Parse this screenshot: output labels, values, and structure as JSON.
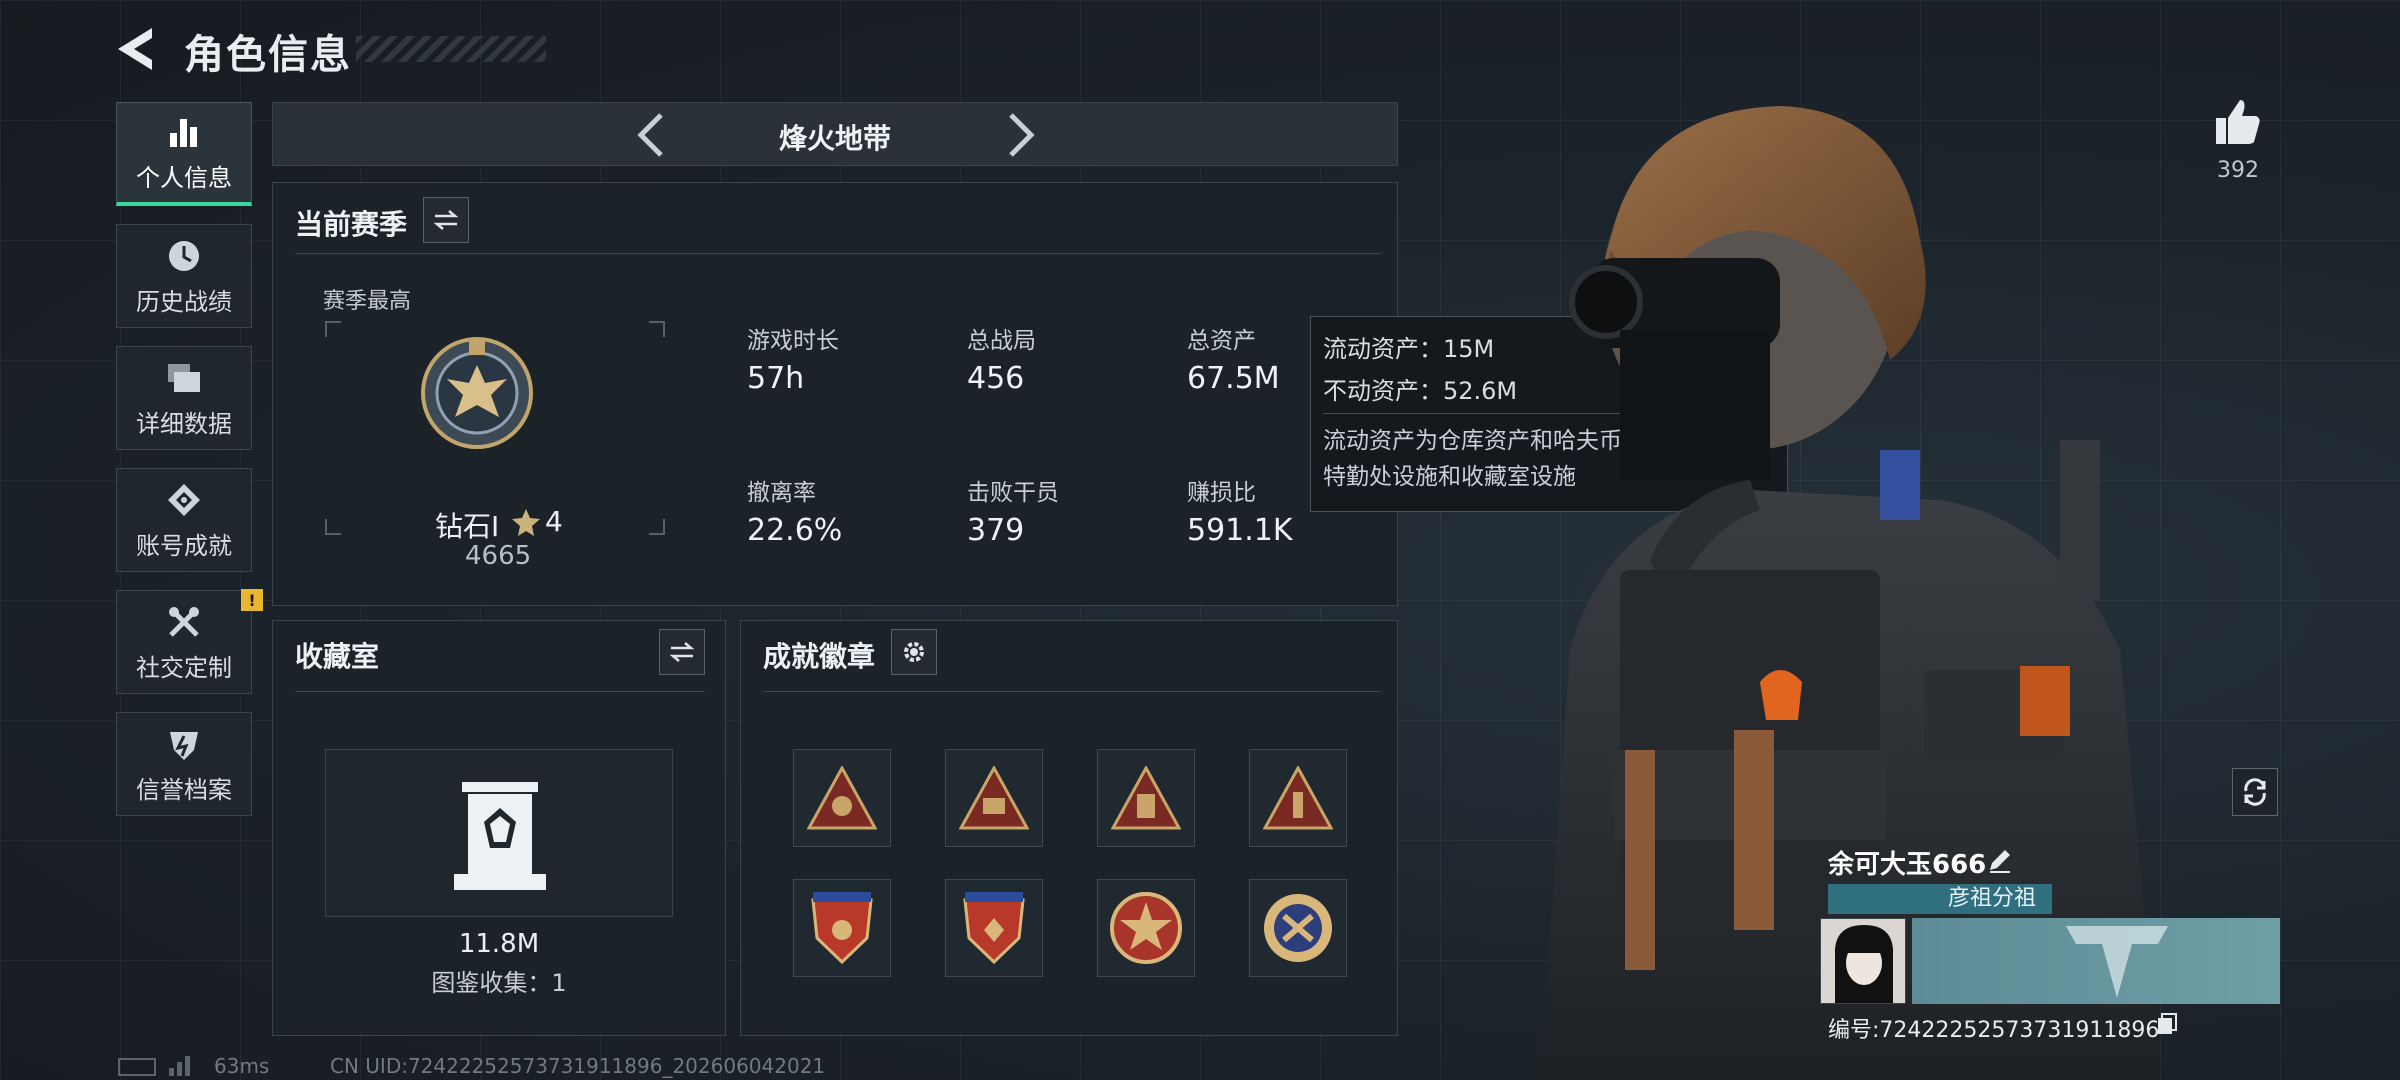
{
  "header": {
    "title": "角色信息"
  },
  "nav": {
    "items": [
      {
        "label": "个人信息",
        "icon": "bar-chart-icon",
        "active": true
      },
      {
        "label": "历史战绩",
        "icon": "clock-icon"
      },
      {
        "label": "详细数据",
        "icon": "folder-icon"
      },
      {
        "label": "账号成就",
        "icon": "medal-icon"
      },
      {
        "label": "社交定制",
        "icon": "tools-icon",
        "alert": "!"
      },
      {
        "label": "信誉档案",
        "icon": "shield-icon"
      }
    ]
  },
  "mode": {
    "title": "烽火地带"
  },
  "season": {
    "title": "当前赛季",
    "best_label": "赛季最高",
    "rank_name": "钻石I",
    "rank_stars": "4",
    "rank_points": "4665",
    "stats": [
      {
        "label": "游戏时长",
        "value": "57h"
      },
      {
        "label": "总战局",
        "value": "456"
      },
      {
        "label": "总资产",
        "value": "67.5M"
      },
      {
        "label": "撤离率",
        "value": "22.6%"
      },
      {
        "label": "击败干员",
        "value": "379"
      },
      {
        "label": "赚损比",
        "value": "591.1K"
      }
    ]
  },
  "tooltip": {
    "liquid": "流动资产：15M",
    "fixed": "不动资产：52.6M",
    "desc": "流动资产为仓库资产和哈夫币，不动资产为特勤处设施和收藏室设施"
  },
  "collection": {
    "title": "收藏室",
    "value": "11.8M",
    "catalog": "图鉴收集：1"
  },
  "achievements": {
    "title": "成就徽章"
  },
  "player": {
    "likes": "392",
    "name": "余可大玉666",
    "guild": "彦祖分祖",
    "id": "编号:7242225257373191189​6"
  },
  "footer": {
    "ping": "63ms",
    "uid": "CN UID:7242225257373191189​6_202606042021"
  },
  "colors": {
    "accent": "#39d59a",
    "warning": "#e8b731",
    "guild": "#2f6f80"
  }
}
